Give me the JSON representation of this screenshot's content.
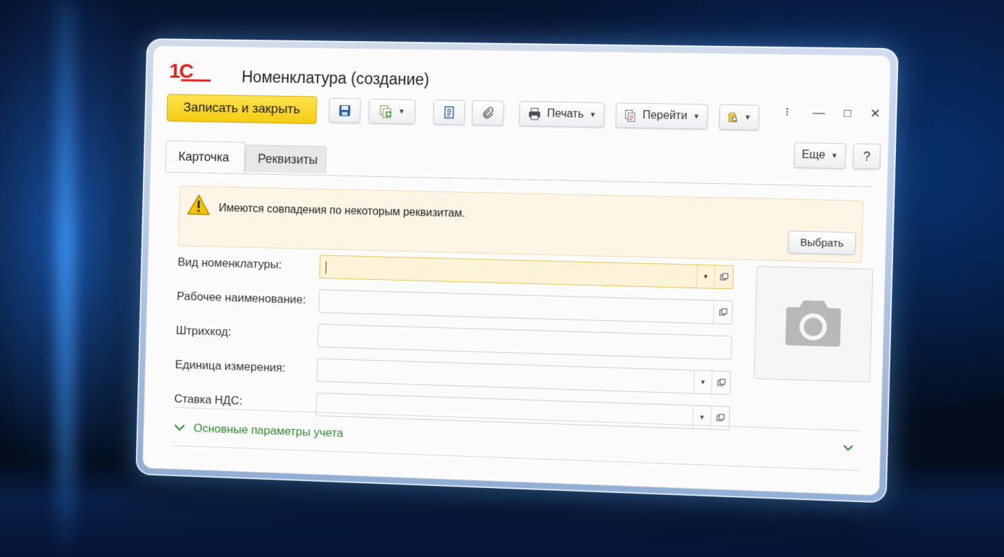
{
  "window": {
    "logo": "1С",
    "title": "Номенклатура (создание)",
    "controls": [
      "⁝",
      "—",
      "□",
      "✕"
    ]
  },
  "toolbar": {
    "save_close": "Записать и закрыть",
    "print": "Печать",
    "goto": "Перейти",
    "more": "Еще",
    "help": "?"
  },
  "tabs": [
    "Карточка",
    "Реквизиты"
  ],
  "warning": {
    "text": "Имеются совпадения по некоторым реквизитам.",
    "button": "Выбрать"
  },
  "form": {
    "fields": [
      {
        "label": "Вид номенклатуры:",
        "value": ""
      },
      {
        "label": "Рабочее наименование:",
        "value": ""
      },
      {
        "label": "Штрихкод:",
        "value": ""
      },
      {
        "label": "Единица измерения:",
        "value": ""
      },
      {
        "label": "Ставка НДС:",
        "value": ""
      }
    ]
  },
  "section": {
    "title": "Основные параметры учета"
  },
  "icons": {
    "save": "floppy-disk-icon",
    "create_copy": "create-based-on-icon",
    "document": "document-icon",
    "attachment": "paperclip-icon",
    "printer": "printer-icon",
    "goto": "goto-icon",
    "report": "report-icon",
    "warning": "warning-triangle-icon",
    "camera": "camera-icon",
    "chevron": "chevron-down-icon"
  },
  "colors": {
    "primary_button": "#f4cc12",
    "logo_red": "#e3201b",
    "warning_bg": "#fdf5e6",
    "section_green": "#2f8a2f"
  }
}
